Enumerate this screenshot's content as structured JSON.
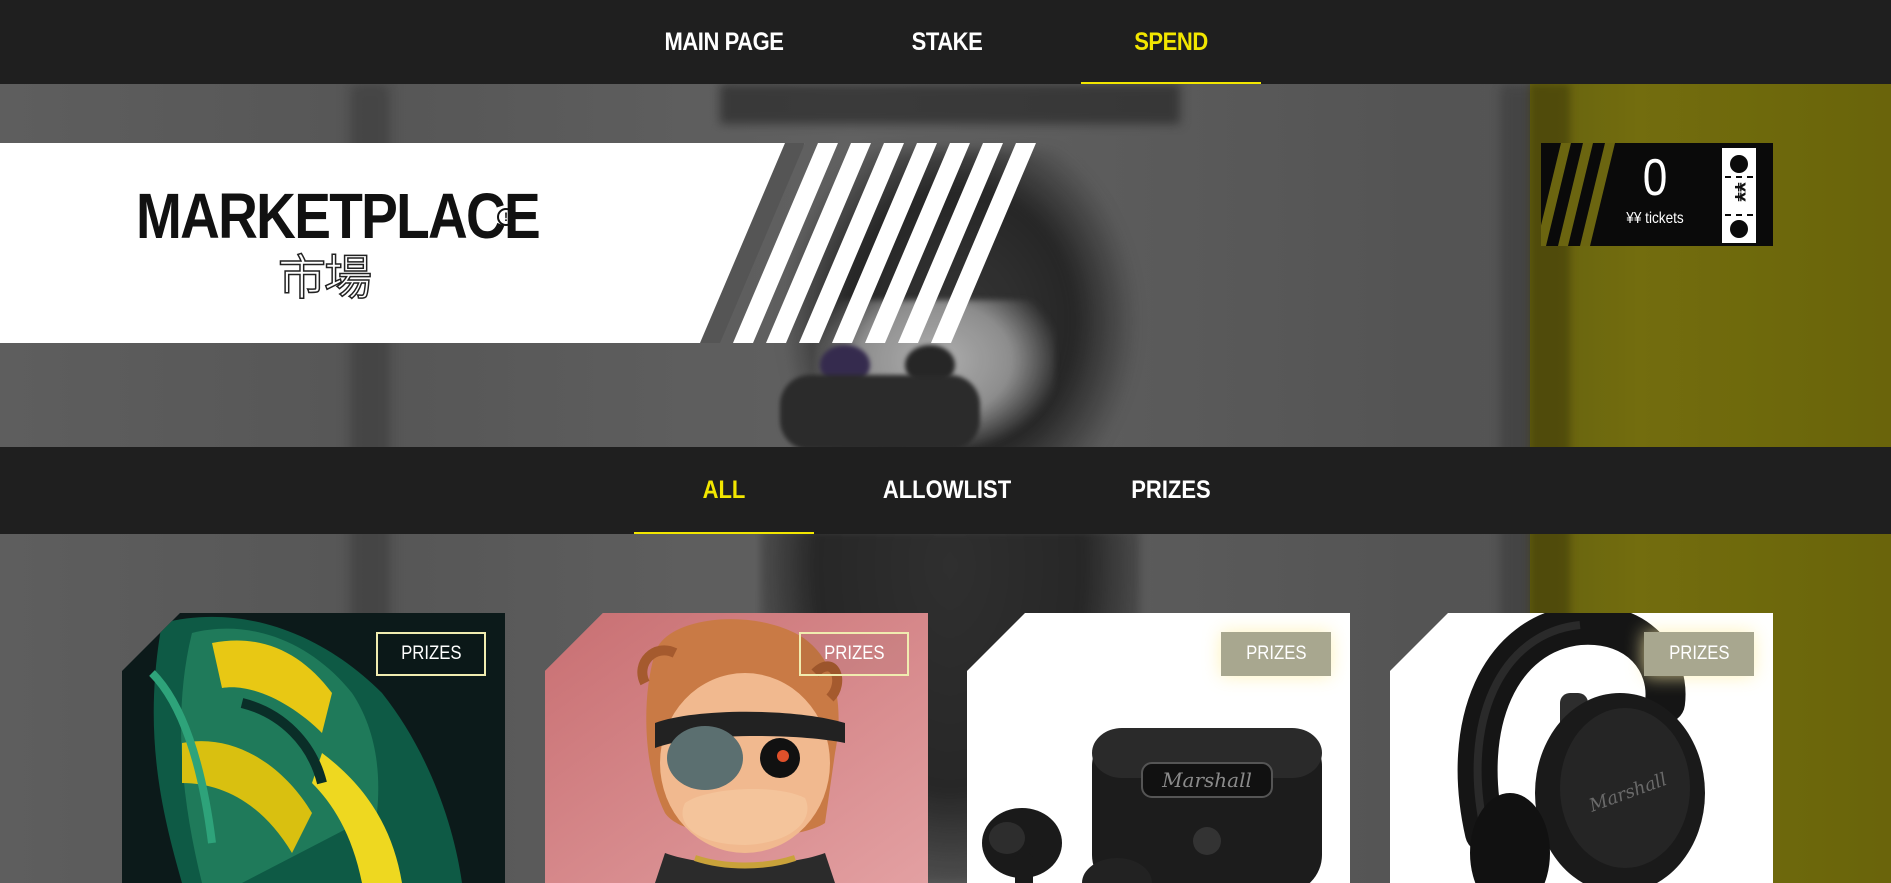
{
  "top_nav": {
    "items": [
      {
        "label": "MAIN PAGE",
        "active": false
      },
      {
        "label": "STAKE",
        "active": false
      },
      {
        "label": "SPEND",
        "active": true
      }
    ]
  },
  "banner": {
    "title": "MARKETPLACE",
    "subtitle": "市場",
    "info_icon": "info-icon"
  },
  "tickets": {
    "count": "0",
    "label": "¥¥ tickets",
    "stub_symbol": "¥¥"
  },
  "category_nav": {
    "items": [
      {
        "label": "ALL",
        "active": true
      },
      {
        "label": "ALLOWLIST",
        "active": false
      },
      {
        "label": "PRIZES",
        "active": false
      }
    ]
  },
  "cards": [
    {
      "tag": "PRIZES",
      "image": "green-yellow-jacket"
    },
    {
      "tag": "PRIZES",
      "image": "duck-character-with-eyepatch"
    },
    {
      "tag": "PRIZES",
      "image": "marshall-earbuds-case"
    },
    {
      "tag": "PRIZES",
      "image": "marshall-headphones"
    }
  ],
  "colors": {
    "accent": "#f2e600",
    "nav_bg": "#1f1f1f",
    "banner_bg": "#ffffff"
  }
}
